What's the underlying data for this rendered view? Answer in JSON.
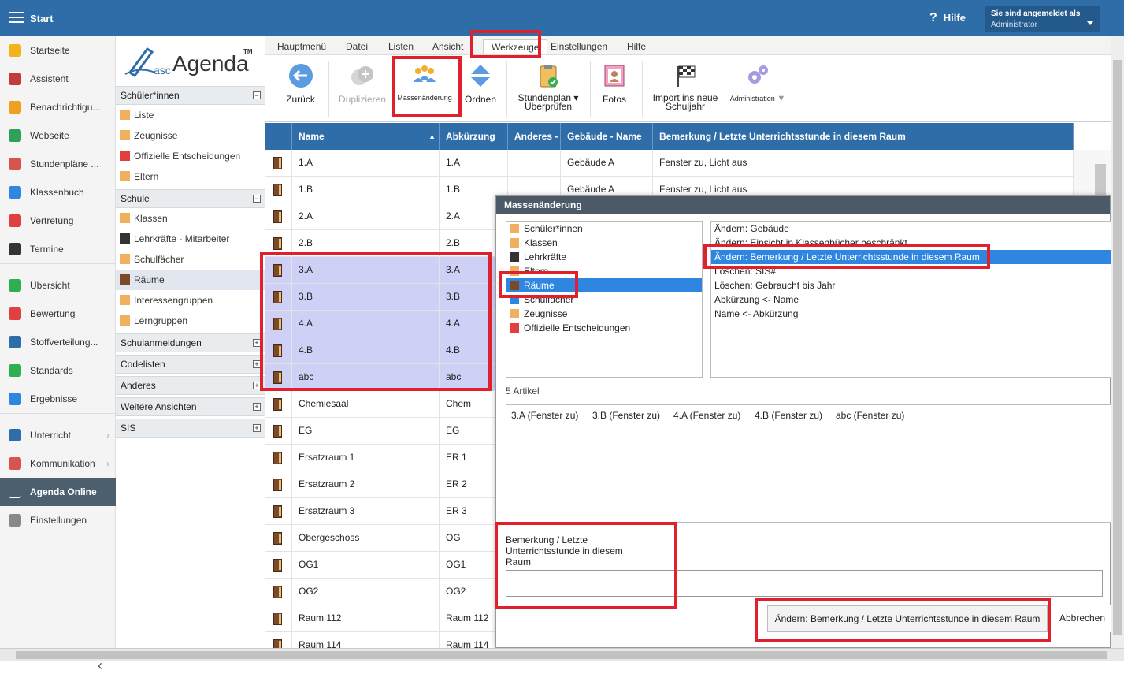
{
  "topbar": {
    "title": "Start",
    "help": "Hilfe",
    "help_glyph": "?",
    "logged_in_label": "Sie sind angemeldet als",
    "user": "Administrator"
  },
  "leftnav": {
    "items": [
      {
        "label": "Startseite",
        "icon": "star-icon",
        "color": "#f3b31b"
      },
      {
        "label": "Assistent",
        "icon": "wand-icon",
        "color": "#c23b3b"
      },
      {
        "label": "Benachrichtigu...",
        "icon": "mail-icon",
        "color": "#f0a020"
      },
      {
        "label": "Webseite",
        "icon": "house-icon",
        "color": "#2fa05a"
      },
      {
        "label": "Stundenpläne ...",
        "icon": "calendar-grid-icon",
        "color": "#d9534f"
      },
      {
        "label": "Klassenbuch",
        "icon": "book-icon",
        "color": "#2f86e0"
      },
      {
        "label": "Vertretung",
        "icon": "person-icon",
        "color": "#e04040"
      },
      {
        "label": "Termine",
        "icon": "calendar-icon",
        "color": "#333333"
      },
      {
        "label": "Übersicht",
        "icon": "check-circle-icon",
        "color": "#2fb050"
      },
      {
        "label": "Bewertung",
        "icon": "rating-icon",
        "color": "#e04040"
      },
      {
        "label": "Stoffverteilung...",
        "icon": "briefcase-icon",
        "color": "#2f6da8"
      },
      {
        "label": "Standards",
        "icon": "shield-check-icon",
        "color": "#2fb050"
      },
      {
        "label": "Ergebnisse",
        "icon": "bar-chart-icon",
        "color": "#2f86e0"
      },
      {
        "label": "Unterricht",
        "icon": "open-book-icon",
        "color": "#2f6da8"
      },
      {
        "label": "Kommunikation",
        "icon": "chat-icon",
        "color": "#d9534f"
      },
      {
        "label": "Agenda Online",
        "icon": "pen-logo-icon",
        "color": "#ffffff"
      },
      {
        "label": "Einstellungen",
        "icon": "gear-icon",
        "color": "#888888"
      }
    ],
    "collapse": "‹"
  },
  "logo": {
    "prefix": "asc",
    "name": "Agenda",
    "tm": "TM"
  },
  "midnav": {
    "groups": [
      {
        "label": "Schüler*innen",
        "toggle": "−",
        "items": [
          {
            "label": "Liste",
            "icon": "student-icon"
          },
          {
            "label": "Zeugnisse",
            "icon": "report-icon"
          },
          {
            "label": "Offizielle Entscheidungen",
            "icon": "pin-icon"
          },
          {
            "label": "Eltern",
            "icon": "parents-icon"
          }
        ]
      },
      {
        "label": "Schule",
        "toggle": "−",
        "items": [
          {
            "label": "Klassen",
            "icon": "class-icon"
          },
          {
            "label": "Lehrkräfte - Mitarbeiter",
            "icon": "graduation-cap-icon"
          },
          {
            "label": "Schulfächer",
            "icon": "subject-book-icon"
          },
          {
            "label": "Räume",
            "icon": "door-icon"
          },
          {
            "label": "Interessengruppen",
            "icon": "interest-group-icon"
          },
          {
            "label": "Lerngruppen",
            "icon": "learning-group-icon"
          }
        ]
      },
      {
        "label": "Schulanmeldungen",
        "toggle": "+"
      },
      {
        "label": "Codelisten",
        "toggle": "+"
      },
      {
        "label": "Anderes",
        "toggle": "+"
      },
      {
        "label": "Weitere Ansichten",
        "toggle": "+"
      },
      {
        "label": "SIS",
        "toggle": "+"
      }
    ]
  },
  "menubar": [
    "Hauptmenü",
    "Datei",
    "Listen",
    "Ansicht",
    "Werkzeuge",
    "Einstellungen",
    "Hilfe"
  ],
  "toolbar": {
    "back": "Zurück",
    "duplicate": "Duplizieren",
    "mass_change": "Massenänderung",
    "order": "Ordnen",
    "timetable_check_1": "Stundenplan",
    "timetable_check_2": "Überprüfen",
    "photos": "Fotos",
    "import_1": "Import ins neue",
    "import_2": "Schuljahr",
    "admin": "Administration"
  },
  "grid": {
    "headers": [
      "Name",
      "Abkürzung",
      "Anderes -",
      "Gebäude - Name",
      "Bemerkung / Letzte Unterrichtsstunde in diesem Raum"
    ],
    "sort_glyph": "▲",
    "rows": [
      {
        "name": "1.A",
        "abbr": "1.A",
        "other": "",
        "building": "Gebäude A",
        "note": "Fenster zu, Licht aus",
        "selected": false
      },
      {
        "name": "1.B",
        "abbr": "1.B",
        "other": "",
        "building": "Gebäude A",
        "note": "Fenster zu, Licht aus",
        "selected": false
      },
      {
        "name": "2.A",
        "abbr": "2.A",
        "other": "",
        "building": "",
        "note": "",
        "selected": false
      },
      {
        "name": "2.B",
        "abbr": "2.B",
        "other": "",
        "building": "",
        "note": "",
        "selected": false
      },
      {
        "name": "3.A",
        "abbr": "3.A",
        "other": "",
        "building": "",
        "note": "",
        "selected": true
      },
      {
        "name": "3.B",
        "abbr": "3.B",
        "other": "",
        "building": "",
        "note": "",
        "selected": true
      },
      {
        "name": "4.A",
        "abbr": "4.A",
        "other": "",
        "building": "",
        "note": "",
        "selected": true
      },
      {
        "name": "4.B",
        "abbr": "4.B",
        "other": "",
        "building": "",
        "note": "",
        "selected": true
      },
      {
        "name": "abc",
        "abbr": "abc",
        "other": "",
        "building": "",
        "note": "",
        "selected": true
      },
      {
        "name": "Chemiesaal",
        "abbr": "Chem",
        "other": "",
        "building": "",
        "note": "",
        "selected": false
      },
      {
        "name": "EG",
        "abbr": "EG",
        "other": "",
        "building": "",
        "note": "",
        "selected": false
      },
      {
        "name": "Ersatzraum 1",
        "abbr": "ER 1",
        "other": "",
        "building": "",
        "note": "",
        "selected": false
      },
      {
        "name": "Ersatzraum 2",
        "abbr": "ER 2",
        "other": "",
        "building": "",
        "note": "",
        "selected": false
      },
      {
        "name": "Ersatzraum 3",
        "abbr": "ER 3",
        "other": "",
        "building": "",
        "note": "",
        "selected": false
      },
      {
        "name": "Obergeschoss",
        "abbr": "OG",
        "other": "",
        "building": "",
        "note": "",
        "selected": false
      },
      {
        "name": "OG1",
        "abbr": "OG1",
        "other": "",
        "building": "",
        "note": "",
        "selected": false
      },
      {
        "name": "OG2",
        "abbr": "OG2",
        "other": "",
        "building": "",
        "note": "",
        "selected": false
      },
      {
        "name": "Raum 112",
        "abbr": "Raum 112",
        "other": "",
        "building": "",
        "note": "",
        "selected": false
      },
      {
        "name": "Raum 114",
        "abbr": "Raum 114",
        "other": "",
        "building": "",
        "note": "",
        "selected": false
      }
    ]
  },
  "dialog": {
    "title": "Massenänderung",
    "types": [
      {
        "label": "Schüler*innen",
        "icon": "student-icon",
        "selected": false
      },
      {
        "label": "Klassen",
        "icon": "class-icon",
        "selected": false
      },
      {
        "label": "Lehrkräfte",
        "icon": "graduation-cap-icon",
        "selected": false
      },
      {
        "label": "Eltern",
        "icon": "parents-icon",
        "selected": false
      },
      {
        "label": "Räume",
        "icon": "door-icon",
        "selected": true
      },
      {
        "label": "Schulfächer",
        "icon": "subject-book-icon",
        "selected": false
      },
      {
        "label": "Zeugnisse",
        "icon": "report-icon",
        "selected": false
      },
      {
        "label": "Offizielle Entscheidungen",
        "icon": "pin-icon",
        "selected": false
      }
    ],
    "actions": [
      {
        "label": "Ändern: Gebäude",
        "selected": false
      },
      {
        "label": "Ändern: Einsicht in Klassenbücher beschränkt",
        "selected": false
      },
      {
        "label": "Ändern: Bemerkung / Letzte Unterrichtsstunde in diesem Raum",
        "selected": true
      },
      {
        "label": "Löschen: SIS#",
        "selected": false
      },
      {
        "label": "Löschen: Gebraucht bis Jahr",
        "selected": false
      },
      {
        "label": "Abkürzung <- Name",
        "selected": false
      },
      {
        "label": "Name <- Abkürzung",
        "selected": false
      }
    ],
    "count": "5 Artikel",
    "articles": [
      "3.A (Fenster zu)",
      "3.B (Fenster zu)",
      "4.A (Fenster zu)",
      "4.B (Fenster zu)",
      "abc (Fenster zu)"
    ],
    "field_label": "Bemerkung / Letzte Unterrichtsstunde in diesem Raum",
    "field_value": "",
    "apply_button": "Ändern: Bemerkung / Letzte Unterrichtsstunde in diesem Raum",
    "cancel_button": "Abbrechen"
  },
  "colors": {
    "accent": "#2f6da8",
    "highlight": "#e0202c",
    "selection": "#cfd0f5",
    "list_selection": "#2f86e0"
  }
}
